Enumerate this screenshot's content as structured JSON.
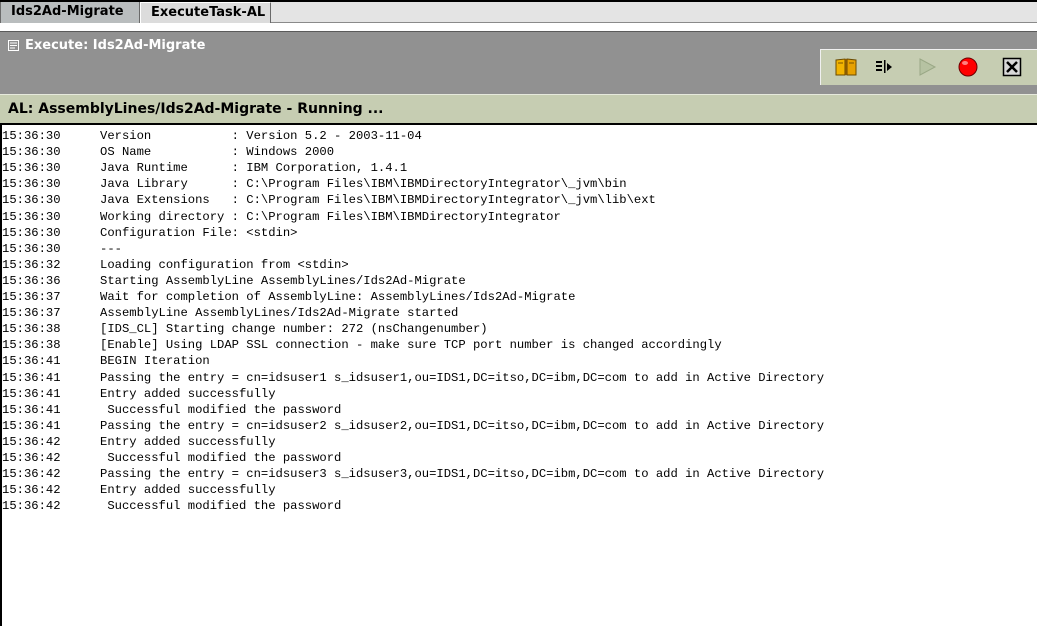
{
  "tabs": [
    {
      "label": "Ids2Ad-Migrate"
    },
    {
      "label": "ExecuteTask-AL"
    }
  ],
  "header": {
    "title": "Execute: Ids2Ad-Migrate"
  },
  "toolbar": {
    "icons": [
      "book-icon",
      "step-icon",
      "run-icon",
      "stop-icon",
      "close-icon"
    ],
    "colors": {
      "stop": "#ff0000",
      "run": "#b6c2a2",
      "book": "#e0a000"
    }
  },
  "status": {
    "text": "AL: AssemblyLines/Ids2Ad-Migrate - Running ..."
  },
  "log": [
    {
      "time": "15:36:30",
      "message": "Version           : Version 5.2 - 2003-11-04"
    },
    {
      "time": "15:36:30",
      "message": "OS Name           : Windows 2000"
    },
    {
      "time": "15:36:30",
      "message": "Java Runtime      : IBM Corporation, 1.4.1"
    },
    {
      "time": "15:36:30",
      "message": "Java Library      : C:\\Program Files\\IBM\\IBMDirectoryIntegrator\\_jvm\\bin"
    },
    {
      "time": "15:36:30",
      "message": "Java Extensions   : C:\\Program Files\\IBM\\IBMDirectoryIntegrator\\_jvm\\lib\\ext"
    },
    {
      "time": "15:36:30",
      "message": "Working directory : C:\\Program Files\\IBM\\IBMDirectoryIntegrator"
    },
    {
      "time": "15:36:30",
      "message": "Configuration File: <stdin>"
    },
    {
      "time": "15:36:30",
      "message": "---"
    },
    {
      "time": "15:36:32",
      "message": "Loading configuration from <stdin>"
    },
    {
      "time": "15:36:36",
      "message": "Starting AssemblyLine AssemblyLines/Ids2Ad-Migrate"
    },
    {
      "time": "15:36:37",
      "message": "Wait for completion of AssemblyLine: AssemblyLines/Ids2Ad-Migrate"
    },
    {
      "time": "15:36:37",
      "message": "AssemblyLine AssemblyLines/Ids2Ad-Migrate started"
    },
    {
      "time": "15:36:38",
      "message": "[IDS_CL] Starting change number: 272 (nsChangenumber)"
    },
    {
      "time": "15:36:38",
      "message": "[Enable] Using LDAP SSL connection - make sure TCP port number is changed accordingly"
    },
    {
      "time": "15:36:41",
      "message": "BEGIN Iteration"
    },
    {
      "time": "15:36:41",
      "message": "Passing the entry = cn=idsuser1 s_idsuser1,ou=IDS1,DC=itso,DC=ibm,DC=com to add in Active Directory"
    },
    {
      "time": "15:36:41",
      "message": "Entry added successfully"
    },
    {
      "time": "15:36:41",
      "message": " Successful modified the password"
    },
    {
      "time": "15:36:41",
      "message": "Passing the entry = cn=idsuser2 s_idsuser2,ou=IDS1,DC=itso,DC=ibm,DC=com to add in Active Directory"
    },
    {
      "time": "15:36:42",
      "message": "Entry added successfully"
    },
    {
      "time": "15:36:42",
      "message": " Successful modified the password"
    },
    {
      "time": "15:36:42",
      "message": "Passing the entry = cn=idsuser3 s_idsuser3,ou=IDS1,DC=itso,DC=ibm,DC=com to add in Active Directory"
    },
    {
      "time": "15:36:42",
      "message": "Entry added successfully"
    },
    {
      "time": "15:36:42",
      "message": " Successful modified the password"
    }
  ]
}
